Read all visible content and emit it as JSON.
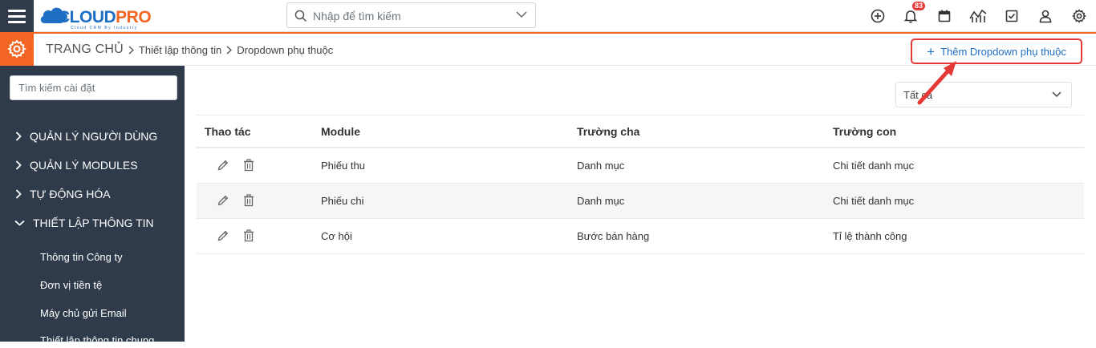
{
  "app": {
    "logo": {
      "part1": "CLOUD",
      "part2": "PRO",
      "tagline": "Cloud CRM By Industry"
    },
    "search_placeholder": "Nhập để tìm kiếm",
    "notification_count": "83",
    "colors": {
      "accent": "#f26522",
      "brand_blue": "#1e6fc4",
      "sidebar": "#2f3b4a",
      "highlight": "#e53935"
    }
  },
  "breadcrumb": {
    "home": "TRANG CHỦ",
    "items": [
      "Thiết lập thông tin",
      "Dropdown phụ thuộc"
    ]
  },
  "actions": {
    "add_label": "Thêm Dropdown phụ thuộc"
  },
  "sidebar": {
    "search_placeholder": "Tìm kiếm cài đặt",
    "sections": [
      {
        "label": "QUẢN LÝ NGƯỜI DÙNG"
      },
      {
        "label": "QUẢN LÝ MODULES"
      },
      {
        "label": "TỰ ĐỘNG HÓA"
      },
      {
        "label": "THIẾT LẬP THÔNG TIN"
      }
    ],
    "sub_items": [
      {
        "label": "Thông tin Công ty"
      },
      {
        "label": "Đơn vị tiền tệ"
      },
      {
        "label": "Máy chủ gửi Email"
      },
      {
        "label": "Thiết lập thông tin chung"
      }
    ]
  },
  "filter": {
    "value": "Tất cả"
  },
  "table": {
    "headers": [
      "Thao tác",
      "Module",
      "Trường cha",
      "Trường con"
    ],
    "rows": [
      {
        "module": "Phiếu thu",
        "parent": "Danh mục",
        "child": "Chi tiết danh mục"
      },
      {
        "module": "Phiếu chi",
        "parent": "Danh mục",
        "child": "Chi tiết danh mục"
      },
      {
        "module": "Cơ hội",
        "parent": "Bước bán hàng",
        "child": "Tỉ lệ thành công"
      }
    ]
  }
}
